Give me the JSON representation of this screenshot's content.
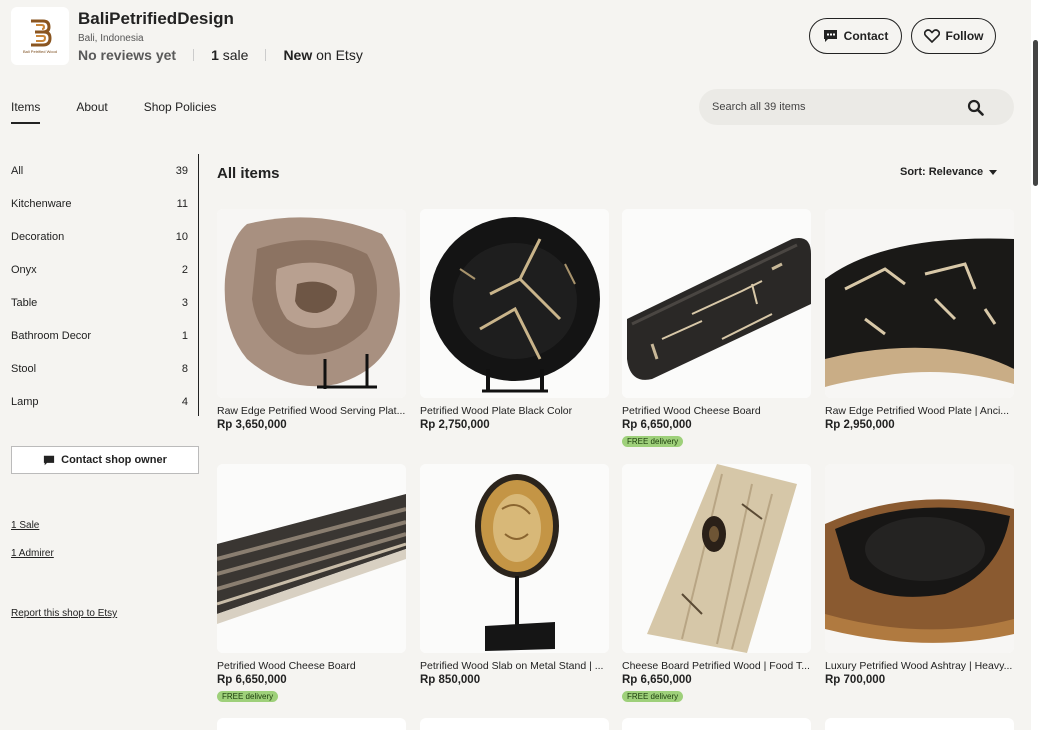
{
  "shop": {
    "name": "BaliPetrifiedDesign",
    "location": "Bali, Indonesia",
    "reviews": "No reviews yet",
    "sales_count": "1",
    "sales_label": "sale",
    "new_label": "New",
    "on_etsy": "on Etsy",
    "logo_caption": "Bali Petrified Wood"
  },
  "buttons": {
    "contact": "Contact",
    "follow": "Follow",
    "contact_owner": "Contact shop owner"
  },
  "tabs": [
    {
      "label": "Items",
      "active": true
    },
    {
      "label": "About",
      "active": false
    },
    {
      "label": "Shop Policies",
      "active": false
    }
  ],
  "search": {
    "placeholder": "Search all 39 items"
  },
  "categories": [
    {
      "label": "All",
      "count": "39"
    },
    {
      "label": "Kitchenware",
      "count": "11"
    },
    {
      "label": "Decoration",
      "count": "10"
    },
    {
      "label": "Onyx",
      "count": "2"
    },
    {
      "label": "Table",
      "count": "3"
    },
    {
      "label": "Bathroom Decor",
      "count": "1"
    },
    {
      "label": "Stool",
      "count": "8"
    },
    {
      "label": "Lamp",
      "count": "4"
    }
  ],
  "side_links": {
    "sales": "1 Sale",
    "admirer": "1 Admirer",
    "report": "Report this shop to Etsy"
  },
  "main": {
    "heading": "All items",
    "sort_label": "Sort: Relevance"
  },
  "items": [
    {
      "title": "Raw Edge Petrified Wood Serving Plat...",
      "price": "Rp 3,650,000",
      "badge": ""
    },
    {
      "title": "Petrified Wood Plate Black Color",
      "price": "Rp 2,750,000",
      "badge": ""
    },
    {
      "title": "Petrified Wood Cheese Board",
      "price": "Rp 6,650,000",
      "badge": "FREE delivery"
    },
    {
      "title": "Raw Edge Petrified Wood Plate | Anci...",
      "price": "Rp 2,950,000",
      "badge": ""
    },
    {
      "title": "Petrified Wood Cheese Board",
      "price": "Rp 6,650,000",
      "badge": "FREE delivery"
    },
    {
      "title": "Petrified Wood Slab on Metal Stand | ...",
      "price": "Rp 850,000",
      "badge": ""
    },
    {
      "title": "Cheese Board Petrified Wood | Food T...",
      "price": "Rp 6,650,000",
      "badge": "FREE delivery"
    },
    {
      "title": "Luxury Petrified Wood Ashtray | Heavy...",
      "price": "Rp 700,000",
      "badge": ""
    }
  ],
  "colors": {
    "accent": "#222222",
    "badge_green": "#9ed07a",
    "background": "#f5f4f1"
  }
}
